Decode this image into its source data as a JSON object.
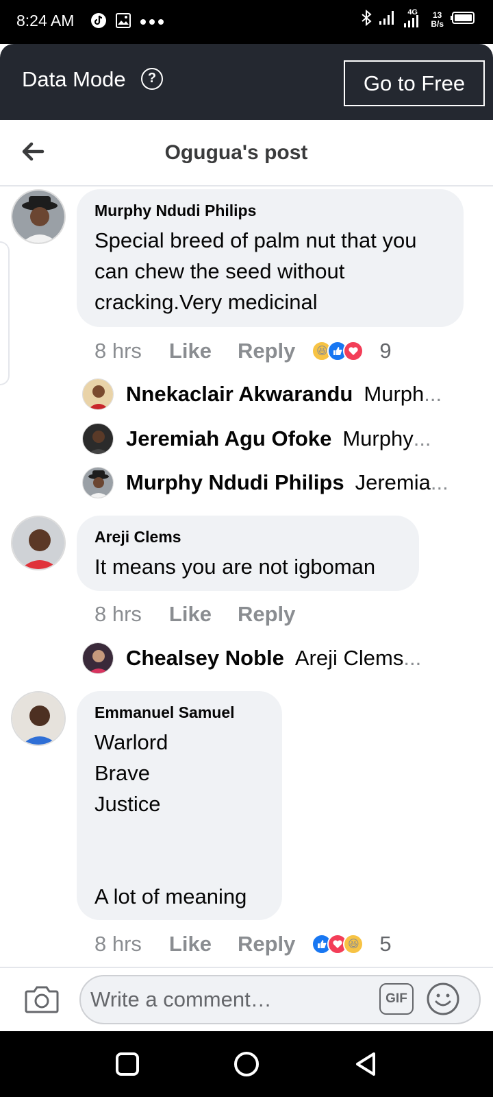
{
  "status_bar": {
    "time": "8:24 AM",
    "network_type": "4G",
    "speed_value": "13",
    "speed_unit": "B/s",
    "icons": [
      "tiktok-icon",
      "gallery-icon",
      "more-dots-icon",
      "bluetooth-icon",
      "signal-icon",
      "signal-4g-icon",
      "battery-icon"
    ]
  },
  "data_mode": {
    "title": "Data Mode",
    "help_glyph": "?",
    "button_label": "Go to Free"
  },
  "header": {
    "title": "Ogugua's post"
  },
  "comments": [
    {
      "author": "Murphy Ndudi Philips",
      "text": "Special breed of palm nut that you\ncan chew the seed without\ncracking.Very medicinal",
      "time": "8 hrs",
      "like": "Like",
      "reply": "Reply",
      "reactions": [
        "haha",
        "like",
        "love"
      ],
      "reaction_count": "9",
      "replies": [
        {
          "name": "Nnekaclair Akwarandu",
          "preview": "Murph",
          "ellipsis": "..."
        },
        {
          "name": "Jeremiah Agu Ofoke",
          "preview": "Murphy ",
          "ellipsis": "..."
        },
        {
          "name": "Murphy Ndudi Philips",
          "preview": "Jeremia",
          "ellipsis": "..."
        }
      ]
    },
    {
      "author": "Areji Clems",
      "text": "It means you are not igboman",
      "time": "8 hrs",
      "like": "Like",
      "reply": "Reply",
      "replies": [
        {
          "name": "Chealsey Noble",
          "preview": "Areji Clems ",
          "ellipsis": "..."
        }
      ]
    },
    {
      "author": "Emmanuel Samuel",
      "text": "Warlord\nBrave\nJustice\n\n\nA lot of meaning",
      "time": "8 hrs",
      "like": "Like",
      "reply": "Reply",
      "reactions": [
        "like",
        "love",
        "haha"
      ],
      "reaction_count": "5"
    }
  ],
  "composer": {
    "placeholder": "Write a comment…",
    "gif_label": "GIF"
  },
  "colors": {
    "data_bar": "#242830",
    "bubble": "#f0f2f5",
    "secondary_text": "#8a8d91",
    "like_blue": "#1877f2",
    "love_red": "#f33e58",
    "haha_yellow": "#f7c344"
  }
}
